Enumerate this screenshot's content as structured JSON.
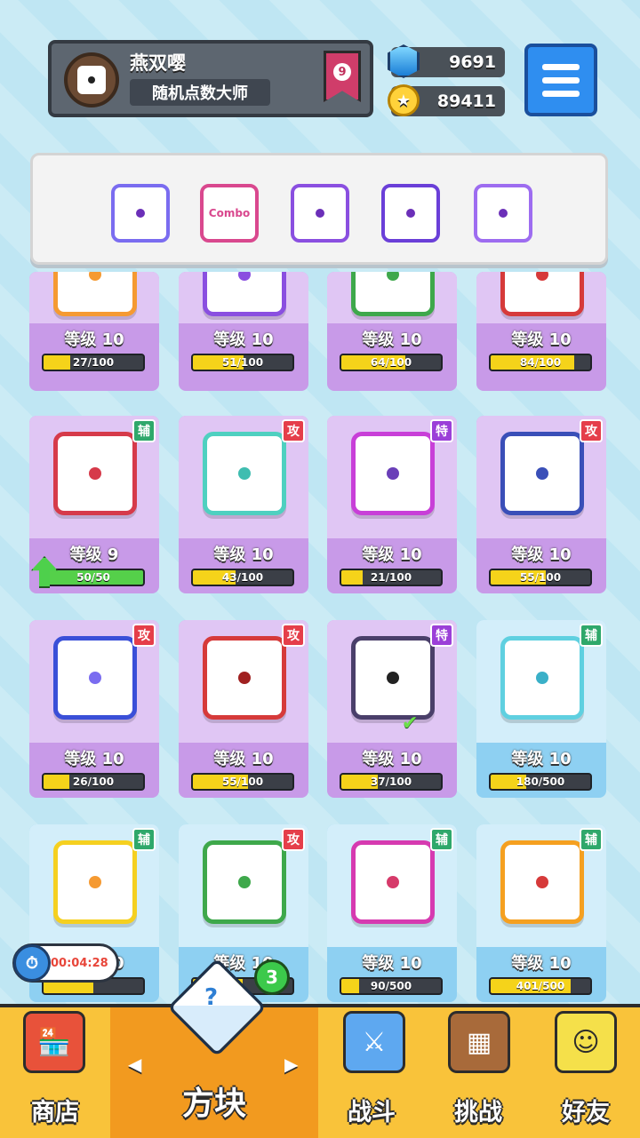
{
  "player": {
    "name": "燕双嘤",
    "title": "随机点数大师",
    "rank": "9"
  },
  "currency": {
    "gems": "9691",
    "coins": "89411"
  },
  "equipped": {
    "dice": [
      {
        "icon": "infinity-die-icon",
        "color": "#7a6cf0"
      },
      {
        "icon": "combo-die-icon",
        "color": "#d9488e",
        "text": "Combo"
      },
      {
        "icon": "orbit-die-icon",
        "color": "#8a4fe0"
      },
      {
        "icon": "core-die-icon",
        "color": "#6a3fd8"
      },
      {
        "icon": "crack-die-icon",
        "color": "#9d6cf0"
      }
    ]
  },
  "cards_row0": [
    {
      "level": "等级 10",
      "progress": "27/100",
      "fill": 0.27,
      "color": "#f59a32"
    },
    {
      "level": "等级 10",
      "progress": "51/100",
      "fill": 0.51,
      "color": "#8a4fe0"
    },
    {
      "level": "等级 10",
      "progress": "64/100",
      "fill": 0.64,
      "color": "#3ea84b"
    },
    {
      "level": "等级 10",
      "progress": "84/100",
      "fill": 0.84,
      "color": "#d63a3a"
    }
  ],
  "cards_row1": [
    {
      "level": "等级 9",
      "progress": "50/50",
      "fill": 1.0,
      "tag": "辅",
      "tag_type": "support",
      "color": "#d63a4a",
      "pip": "#d63a4a"
    },
    {
      "level": "等级 10",
      "progress": "43/100",
      "fill": 0.43,
      "tag": "攻",
      "tag_type": "attack",
      "color": "#4fd0c0",
      "pip": "#3fbdb0"
    },
    {
      "level": "等级 10",
      "progress": "21/100",
      "fill": 0.21,
      "tag": "特",
      "tag_type": "special",
      "color": "#c83fd8",
      "pip": "#6a3fb8"
    },
    {
      "level": "等级 10",
      "progress": "55/100",
      "fill": 0.55,
      "tag": "攻",
      "tag_type": "attack",
      "color": "#3a4fb8",
      "pip": "#3a4fb8"
    }
  ],
  "cards_row2": [
    {
      "level": "等级 10",
      "progress": "26/100",
      "fill": 0.26,
      "tag": "攻",
      "tag_type": "attack",
      "color": "#3a4fd8",
      "pip": "#7a6cf0"
    },
    {
      "level": "等级 10",
      "progress": "55/100",
      "fill": 0.55,
      "tag": "攻",
      "tag_type": "attack",
      "color": "#d63a3a",
      "pip": "#a02020"
    },
    {
      "level": "等级 10",
      "progress": "37/100",
      "fill": 0.37,
      "tag": "特",
      "tag_type": "special",
      "color": "#4a3f6a",
      "pip": "#222"
    },
    {
      "level": "等级 10",
      "progress": "180/500",
      "fill": 0.36,
      "tag": "辅",
      "tag_type": "support",
      "color": "#5fd0e0",
      "pip": "#3ab0c8"
    }
  ],
  "cards_row3": [
    {
      "level": "等级 10",
      "progress": "",
      "fill": 0.5,
      "tag": "辅",
      "tag_type": "support",
      "color": "#f5d020",
      "pip": "#f59a32"
    },
    {
      "level": "等级 10",
      "progress": "",
      "fill": 0.5,
      "tag": "攻",
      "tag_type": "attack",
      "color": "#3ea84b",
      "pip": "#3ea84b"
    },
    {
      "level": "等级 10",
      "progress": "90/500",
      "fill": 0.18,
      "tag": "辅",
      "tag_type": "support",
      "color": "#d63ab0",
      "pip": "#d63a6a"
    },
    {
      "level": "等级 10",
      "progress": "401/500",
      "fill": 0.8,
      "tag": "辅",
      "tag_type": "support",
      "color": "#f5a020",
      "pip": "#d63a3a"
    }
  ],
  "timer": "00:04:28",
  "box_badge": "3",
  "nav": {
    "shop": "商店",
    "dice": "方块",
    "battle": "战斗",
    "challenge": "挑战",
    "friends": "好友"
  }
}
